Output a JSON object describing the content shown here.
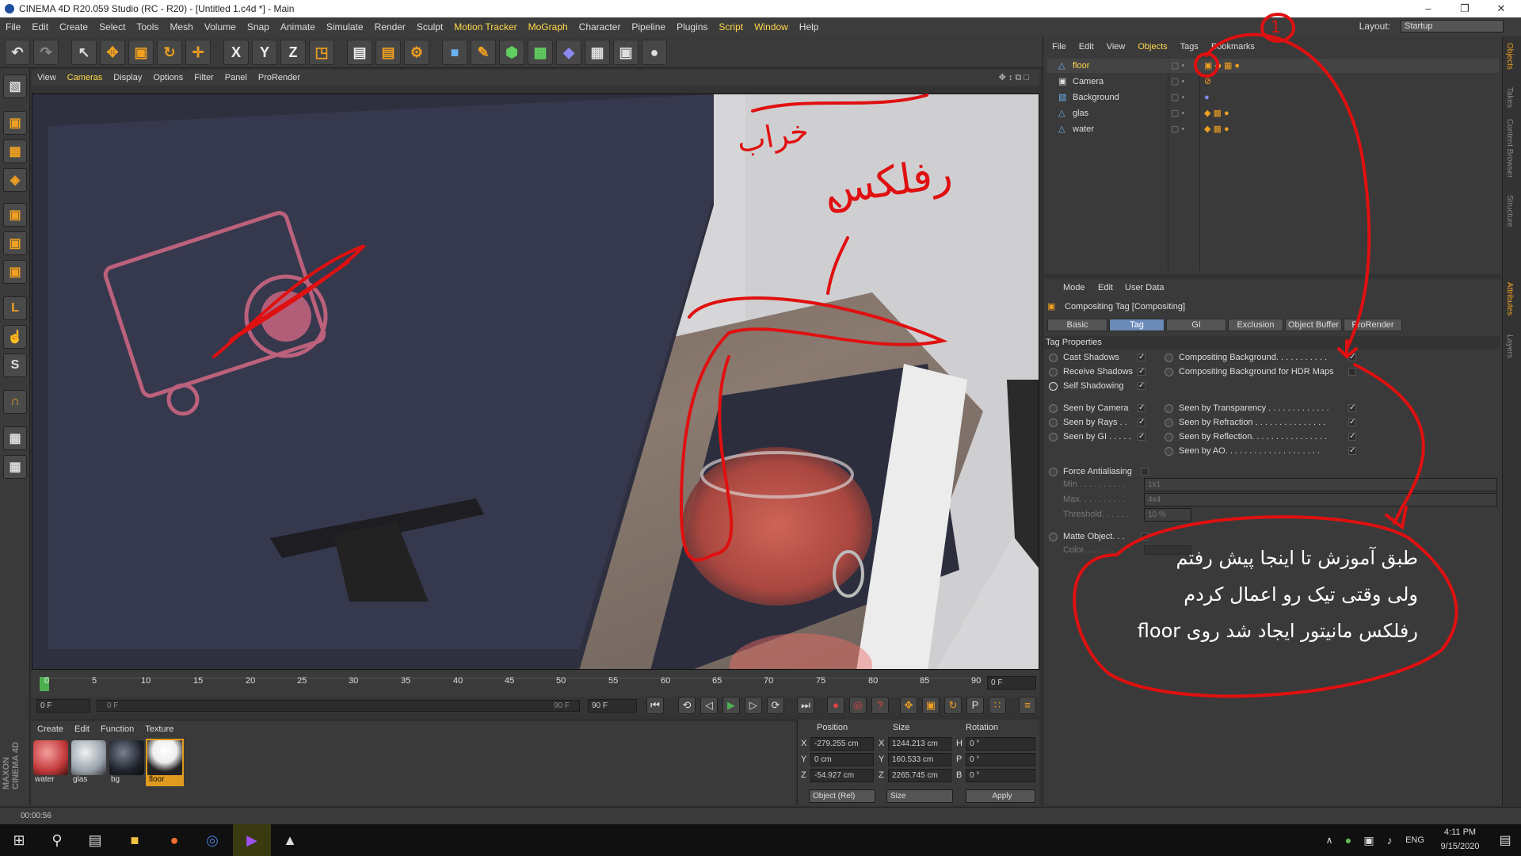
{
  "window": {
    "title": "CINEMA 4D R20.059 Studio (RC - R20) - [Untitled 1.c4d *] - Main"
  },
  "menubar": {
    "items": [
      "File",
      "Edit",
      "Create",
      "Select",
      "Tools",
      "Mesh",
      "Volume",
      "Snap",
      "Animate",
      "Simulate",
      "Render",
      "Sculpt",
      "Motion Tracker",
      "MoGraph",
      "Character",
      "Pipeline",
      "Plugins",
      "Script",
      "Window",
      "Help"
    ],
    "layout_label": "Layout:",
    "layout_value": "Startup"
  },
  "viewport": {
    "menu": [
      "View",
      "Cameras",
      "Display",
      "Options",
      "Filter",
      "Panel",
      "ProRender"
    ]
  },
  "timeline": {
    "ticks": [
      "0",
      "5",
      "10",
      "15",
      "20",
      "25",
      "30",
      "35",
      "40",
      "45",
      "50",
      "55",
      "60",
      "65",
      "70",
      "75",
      "80",
      "85",
      "90"
    ],
    "current_frame": "0 F",
    "start": "0 F",
    "slider_start": "0 F",
    "slider_end": "90 F",
    "end": "90 F"
  },
  "materials": {
    "menu": [
      "Create",
      "Edit",
      "Function",
      "Texture"
    ],
    "items": [
      {
        "name": "water",
        "color": "#c43a3a"
      },
      {
        "name": "glas",
        "color": "#9aa4ad"
      },
      {
        "name": "bg",
        "color": "#20242e"
      },
      {
        "name": "floor",
        "color": "#222"
      }
    ]
  },
  "coords": {
    "headers": [
      "Position",
      "Size",
      "Rotation"
    ],
    "rows": [
      {
        "axis": "X",
        "pos": "-279.255 cm",
        "saxis": "X",
        "size": "1244.213 cm",
        "raxis": "H",
        "rot": "0 °"
      },
      {
        "axis": "Y",
        "pos": "0 cm",
        "saxis": "Y",
        "size": "160.533 cm",
        "raxis": "P",
        "rot": "0 °"
      },
      {
        "axis": "Z",
        "pos": "-54.927 cm",
        "saxis": "Z",
        "size": "2265.745 cm",
        "raxis": "B",
        "rot": "0 °"
      }
    ],
    "mode": "Object (Rel)",
    "size_mode": "Size",
    "apply": "Apply"
  },
  "status": {
    "time": "00:00:56"
  },
  "objects": {
    "menu": [
      "File",
      "Edit",
      "View",
      "Objects",
      "Tags",
      "Bookmarks"
    ],
    "rows": [
      "floor",
      "Camera",
      "Background",
      "glas",
      "water"
    ]
  },
  "attributes": {
    "menu": [
      "Mode",
      "Edit",
      "User Data"
    ],
    "title": "Compositing Tag [Compositing]",
    "tabs": [
      "Basic",
      "Tag",
      "GI",
      "Exclusion",
      "Object Buffer",
      "ProRender"
    ],
    "section": "Tag Properties",
    "left_props": [
      "Cast Shadows",
      "Receive Shadows",
      "Self Shadowing",
      "Seen by Camera",
      "Seen by Rays . .",
      "Seen by GI . . . . ."
    ],
    "right_props": [
      "Compositing Background. . . . . . . . . . .",
      "Compositing Background for HDR Maps",
      "Seen by Transparency . . . . . . . . . . . . .",
      "Seen by Refraction . . . . . . . . . . . . . . .",
      "Seen by Reflection. . . . . . . . . . . . . . . .",
      "Seen by AO. . . . . . . . . . . . . . . . . . . ."
    ],
    "force_aa": "Force Antialiasing",
    "min_label": "Min . . . . . . . . . .",
    "min_value": "1x1",
    "max_label": "Max. . . . . . . . . .",
    "max_value": "4x4",
    "threshold_label": "Threshold. . . . . .",
    "threshold_value": "10 %",
    "matte": "Matte Object. . .",
    "color": "Color. . . . . . . ."
  },
  "annotations": {
    "num": "1",
    "line1": "طبق آموزش تا اینجا پیش رفتم",
    "line2": "ولی وقتی تیک رو اعمال کردم",
    "line3": "رفلکس مانیتور ایجاد شد روی floor",
    "word1": "خراب",
    "word2": "رفلکس"
  },
  "taskbar": {
    "time": "4:11 PM",
    "date": "9/15/2020",
    "lang": "ENG"
  },
  "sidetabs": [
    "Objects",
    "Takes",
    "Content Browser",
    "Structure",
    "Attributes",
    "Layers"
  ]
}
